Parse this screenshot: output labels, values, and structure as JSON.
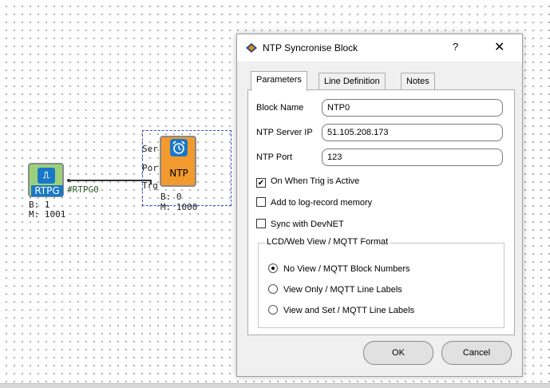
{
  "diagram": {
    "rtpg": {
      "label": "RTPG",
      "icon": "waveform-clock-icon",
      "output_tag": "#RTPG0",
      "b_text": "B: 1",
      "m_text": "M: 1001"
    },
    "ntp": {
      "label": "NTP",
      "icon": "alarm-clock-icon",
      "ports": [
        "Ser",
        "Por",
        "Trg"
      ],
      "b_text": "B: 0",
      "m_text": "M: 1000"
    }
  },
  "dialog": {
    "title": "NTP Syncronise Block",
    "help_label": "?",
    "close_label": "✕",
    "tabs": [
      {
        "label": "Parameters",
        "active": true
      },
      {
        "label": "Line Definition",
        "active": false
      },
      {
        "label": "Notes",
        "active": false
      }
    ],
    "fields": {
      "block_name": {
        "label": "Block Name",
        "value": "NTP0"
      },
      "server_ip": {
        "label": "NTP Server IP",
        "value": "51.105.208.173"
      },
      "port": {
        "label": "NTP Port",
        "value": "123"
      }
    },
    "checkboxes": [
      {
        "label": "On When Trig is Active",
        "checked": true
      },
      {
        "label": "Add to log-record memory",
        "checked": false
      },
      {
        "label": "Sync with DevNET",
        "checked": false
      }
    ],
    "group": {
      "title": "LCD/Web View / MQTT Format",
      "options": [
        {
          "label": "No View / MQTT Block Numbers",
          "selected": true
        },
        {
          "label": "View Only / MQTT Line Labels",
          "selected": false
        },
        {
          "label": "View and Set / MQTT Line Labels",
          "selected": false
        }
      ]
    },
    "ok_label": "OK",
    "cancel_label": "Cancel"
  }
}
